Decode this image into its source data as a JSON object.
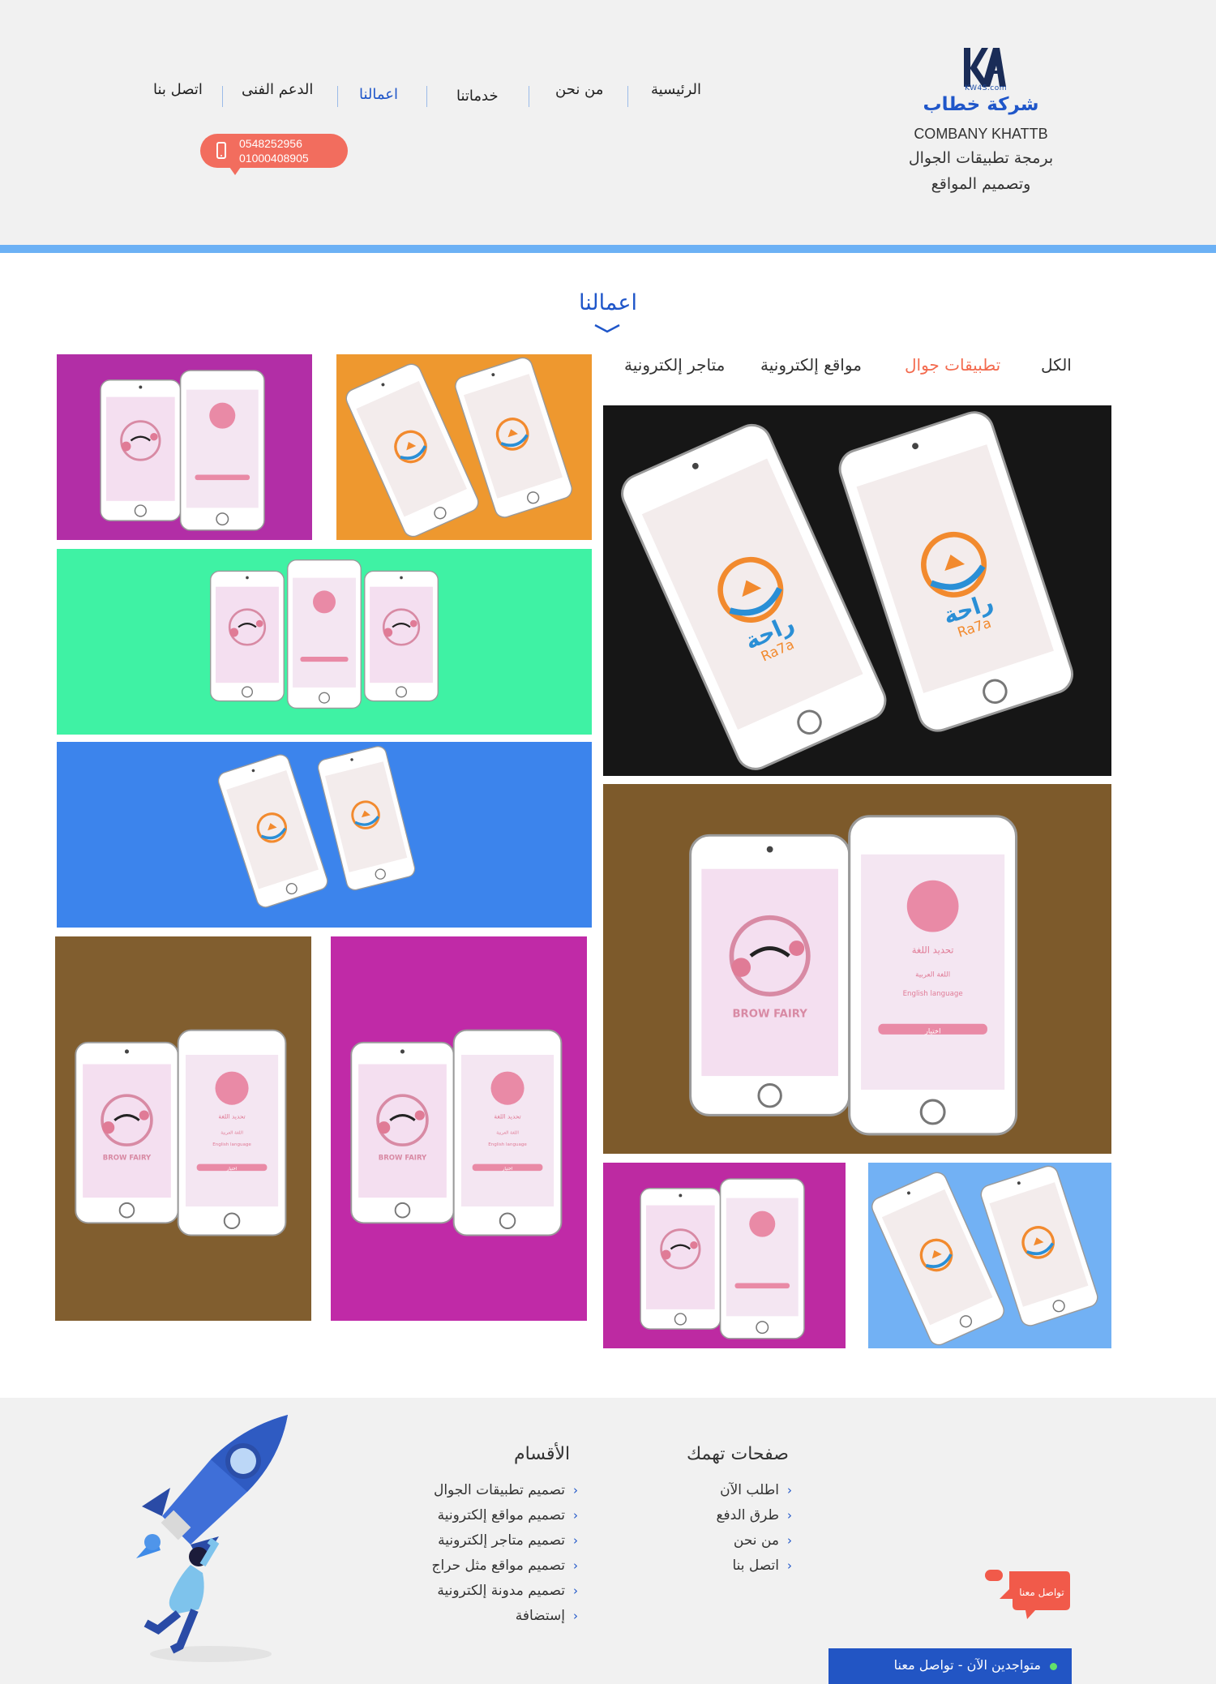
{
  "brand": {
    "logo_sub": "KW4S.com",
    "name_ar": "شركة خطاب",
    "name_en": "COMBANY KHATTB",
    "tagline_1": "برمجة تطبيقات الجوال",
    "tagline_2": "وتصميم المواقع"
  },
  "nav": {
    "items": [
      {
        "label": "الرئيسية",
        "active": false
      },
      {
        "label": "من نحن",
        "active": false
      },
      {
        "label": "خدماتنا",
        "active": false
      },
      {
        "label": "اعمالنا",
        "active": true
      },
      {
        "label": "الدعم الفنى",
        "active": false
      },
      {
        "label": "اتصل بنا",
        "active": false
      }
    ]
  },
  "contact_phones": [
    "0548252956",
    "01000408905"
  ],
  "portfolio": {
    "title": "اعمالنا",
    "filters": [
      {
        "label": "الكل",
        "active": false
      },
      {
        "label": "تطبيقات جوال",
        "active": true
      },
      {
        "label": "مواقع إلكترونية",
        "active": false
      },
      {
        "label": "متاجر إلكترونية",
        "active": false
      }
    ],
    "tiles": [
      {
        "app": "raha",
        "bg": "#161616"
      },
      {
        "app": "brow",
        "bg": "#7d5a2b"
      },
      {
        "app": "brow",
        "bg": "#bd2aa2"
      },
      {
        "app": "raha",
        "bg": "#72b1f4"
      },
      {
        "app": "raha",
        "bg": "#ee982f"
      },
      {
        "app": "brow",
        "bg": "#b22ea6"
      },
      {
        "app": "brow",
        "bg": "#3ff2a4"
      },
      {
        "app": "raha",
        "bg": "#3c84ec"
      },
      {
        "app": "brow",
        "bg": "#815e2f"
      },
      {
        "app": "brow",
        "bg": "#c02aa7"
      }
    ],
    "raha_label_ar": "راحة",
    "raha_label_en": "Ra7a",
    "brow_label": "BROW FAIRY",
    "brow_lang_title": "تحديد اللغة",
    "brow_opt_ar": "اللغة العربية",
    "brow_opt_en": "English language",
    "brow_button": "اختيار"
  },
  "footer": {
    "pages_title": "صفحات تهمك",
    "pages": [
      "اطلب الآن",
      "طرق الدفع",
      "من نحن",
      "اتصل بنا"
    ],
    "sections_title": "الأقسام",
    "sections": [
      "تصميم تطبيقات الجوال",
      "تصميم مواقع إلكترونية",
      "تصميم متاجر إلكترونية",
      "تصميم مواقع مثل حراج",
      "تصميم مدونة إلكترونية",
      "إستضافة"
    ],
    "contact_bubble": "تواصل معنا",
    "chat_bar": "متواجدين الآن - تواصل معنا"
  },
  "colors": {
    "brand_blue": "#1f56c9",
    "accent_orange": "#f36a4e",
    "header_bar": "#6cb1f5",
    "phone_pill": "#f26d5e"
  }
}
